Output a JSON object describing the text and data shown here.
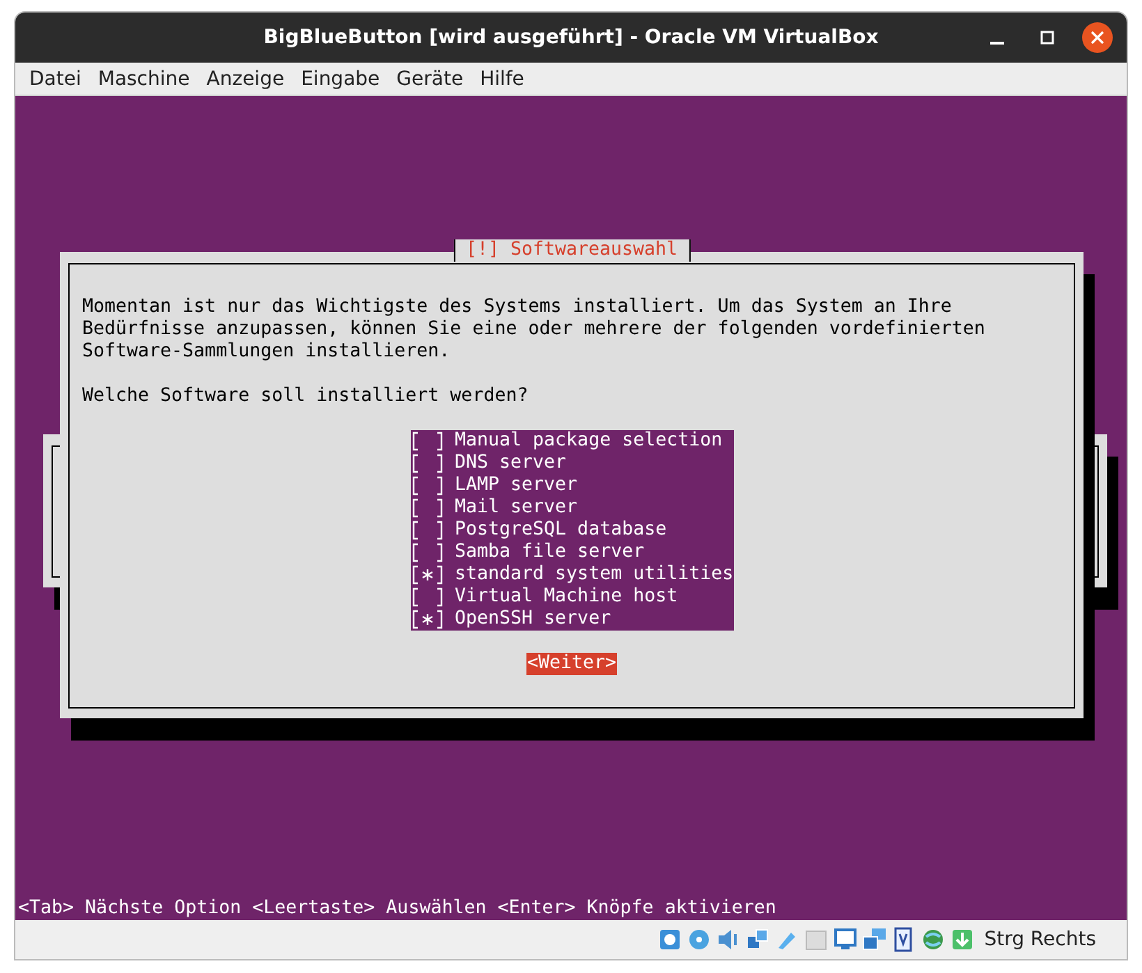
{
  "window": {
    "title": "BigBlueButton [wird ausgeführt] - Oracle VM VirtualBox"
  },
  "menu": [
    "Datei",
    "Maschine",
    "Anzeige",
    "Eingabe",
    "Geräte",
    "Hilfe"
  ],
  "dialog": {
    "title": "[!] Softwareauswahl",
    "intro": "Momentan ist nur das Wichtigste des Systems installiert. Um das System an Ihre Bedürfnisse anzupassen, können Sie eine oder mehrere der folgenden vordefinierten Software-Sammlungen installieren.",
    "question": "Welche Software soll installiert werden?",
    "items": [
      {
        "label": "Manual package selection",
        "checked": false
      },
      {
        "label": "DNS server",
        "checked": false
      },
      {
        "label": "LAMP server",
        "checked": false
      },
      {
        "label": "Mail server",
        "checked": false
      },
      {
        "label": "PostgreSQL database",
        "checked": false
      },
      {
        "label": "Samba file server",
        "checked": false
      },
      {
        "label": "standard system utilities",
        "checked": true
      },
      {
        "label": "Virtual Machine host",
        "checked": false
      },
      {
        "label": "OpenSSH server",
        "checked": true
      }
    ],
    "button": "<Weiter>"
  },
  "help_line": "<Tab> Nächste Option <Leertaste> Auswählen <Enter> Knöpfe aktivieren",
  "status_bar": {
    "host_key": "Strg Rechts"
  }
}
